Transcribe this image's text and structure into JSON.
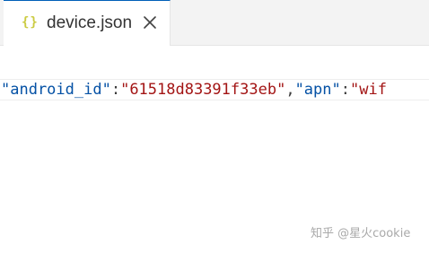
{
  "tab": {
    "icon": "{}",
    "icon_name": "json-braces-icon",
    "filename": "device.json",
    "close_icon": "close-icon"
  },
  "code": {
    "line": {
      "tokens": [
        {
          "type": "key",
          "text": "\"android_id\""
        },
        {
          "type": "punct",
          "text": ":"
        },
        {
          "type": "str",
          "text": "\"61518d83391f33eb\""
        },
        {
          "type": "punct",
          "text": ","
        },
        {
          "type": "key",
          "text": "\"apn\""
        },
        {
          "type": "punct",
          "text": ":"
        },
        {
          "type": "str",
          "text": "\"wif"
        }
      ]
    }
  },
  "watermark": {
    "text": "知乎 @星火cookie"
  },
  "colors": {
    "key": "#0451a5",
    "string": "#a31515",
    "punct": "#3b3b3b",
    "tab_accent": "#005fb8",
    "json_icon": "#cbcb41"
  }
}
